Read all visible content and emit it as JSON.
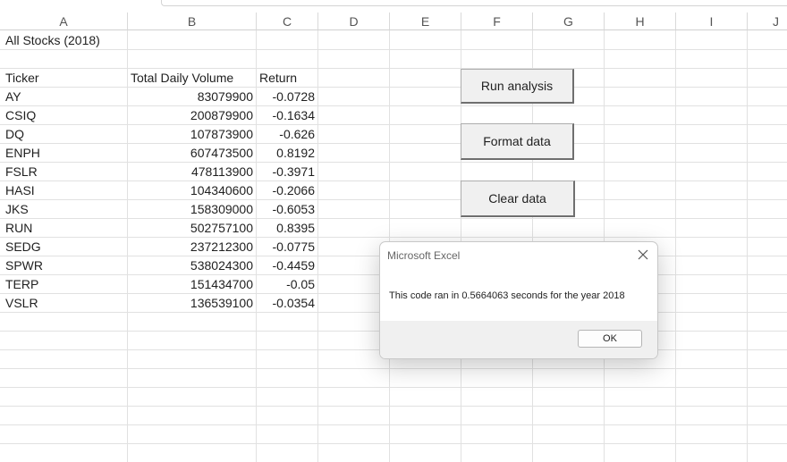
{
  "columns": [
    "A",
    "B",
    "C",
    "D",
    "E",
    "F",
    "G",
    "H",
    "I",
    "J"
  ],
  "sheet": {
    "title": "All Stocks (2018)",
    "headers": {
      "ticker": "Ticker",
      "volume": "Total Daily Volume",
      "return": "Return"
    },
    "rows": [
      {
        "ticker": "AY",
        "volume": "83079900",
        "return": "-0.0728"
      },
      {
        "ticker": "CSIQ",
        "volume": "200879900",
        "return": "-0.1634"
      },
      {
        "ticker": "DQ",
        "volume": "107873900",
        "return": "-0.626"
      },
      {
        "ticker": "ENPH",
        "volume": "607473500",
        "return": "0.8192"
      },
      {
        "ticker": "FSLR",
        "volume": "478113900",
        "return": "-0.3971"
      },
      {
        "ticker": "HASI",
        "volume": "104340600",
        "return": "-0.2066"
      },
      {
        "ticker": "JKS",
        "volume": "158309000",
        "return": "-0.6053"
      },
      {
        "ticker": "RUN",
        "volume": "502757100",
        "return": "0.8395"
      },
      {
        "ticker": "SEDG",
        "volume": "237212300",
        "return": "-0.0775"
      },
      {
        "ticker": "SPWR",
        "volume": "538024300",
        "return": "-0.4459"
      },
      {
        "ticker": "TERP",
        "volume": "151434700",
        "return": "-0.05"
      },
      {
        "ticker": "VSLR",
        "volume": "136539100",
        "return": "-0.0354"
      }
    ]
  },
  "buttons": {
    "run": "Run analysis",
    "format": "Format data",
    "clear": "Clear data"
  },
  "dialog": {
    "title": "Microsoft Excel",
    "message": "This code ran in 0.5664063 seconds for the year 2018",
    "ok": "OK"
  }
}
